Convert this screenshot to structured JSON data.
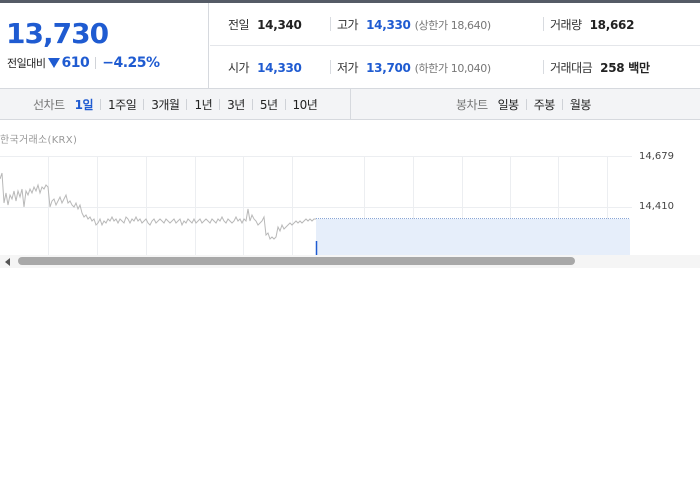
{
  "summary": {
    "price": "13,730",
    "change_label": "전일대비",
    "change_icon": "down-triangle-icon",
    "change_value": "610",
    "change_percent": "−4.25%"
  },
  "info": {
    "prev_close_label": "전일",
    "prev_close": "14,340",
    "high_label": "고가",
    "high": "14,330",
    "upper_limit": "(상한가 18,640)",
    "volume_label": "거래량",
    "volume": "18,662",
    "open_label": "시가",
    "open": "14,330",
    "low_label": "저가",
    "low": "13,700",
    "lower_limit": "(하한가 10,040)",
    "amount_label": "거래대금",
    "amount": "258 백만"
  },
  "tabs": {
    "line_title": "선차트",
    "line_periods": [
      "1일",
      "1주일",
      "3개월",
      "1년",
      "3년",
      "5년",
      "10년"
    ],
    "candle_title": "봉차트",
    "candle_periods": [
      "일봉",
      "주봉",
      "월봉"
    ]
  },
  "chart": {
    "exchange": "한국거래소(KRX)",
    "y_ticks": [
      "14,679",
      "14,410"
    ],
    "colors": {
      "line": "#b8b8b8",
      "projection_fill": "#e6eefa",
      "accent": "#1f5bd1"
    }
  }
}
